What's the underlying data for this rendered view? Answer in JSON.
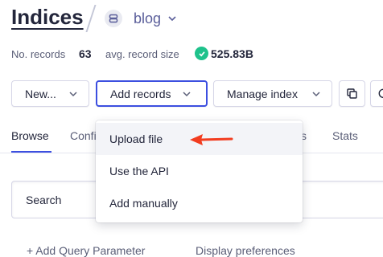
{
  "breadcrumb": {
    "title": "Indices",
    "index_name": "blog"
  },
  "stats": {
    "records_label": "No. records",
    "records_value": "63",
    "size_label": "avg. record size",
    "size_value": "525.83B"
  },
  "toolbar": {
    "new_label": "New...",
    "add_records_label": "Add records",
    "manage_index_label": "Manage index"
  },
  "tabs": [
    "Browse",
    "Confi",
    "s",
    "Stats"
  ],
  "dropdown": {
    "items": [
      "Upload file",
      "Use the API",
      "Add manually"
    ]
  },
  "search": {
    "placeholder": "Search"
  },
  "bottom": {
    "add_query": "+ Add Query Parameter",
    "display": "Display preferences"
  },
  "colors": {
    "accent": "#3c4fe0",
    "success": "#1ec28b",
    "arrow": "#f23c1f"
  }
}
